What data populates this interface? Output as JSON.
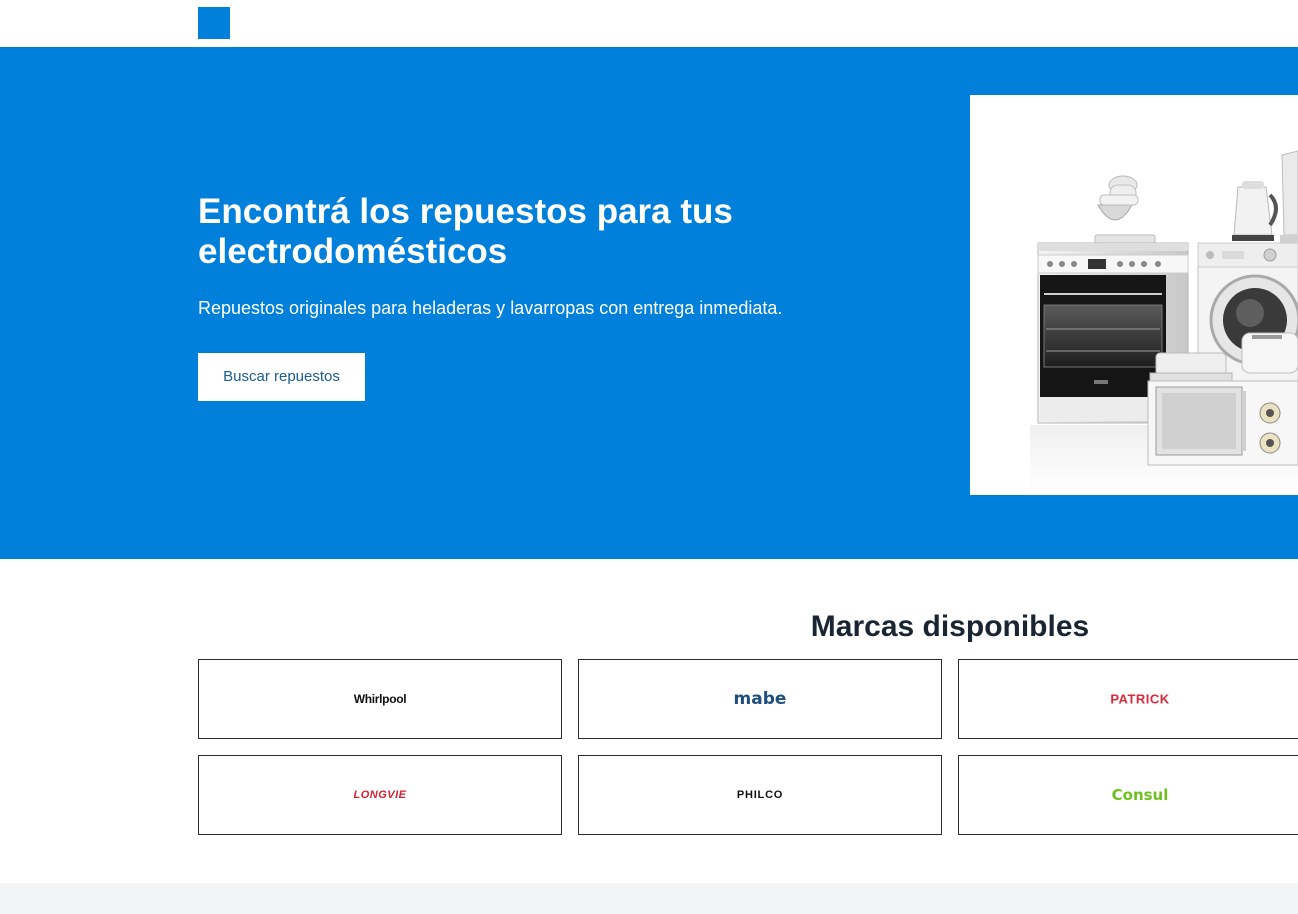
{
  "hero": {
    "title": "Encontrá los repuestos para tus electrodomésticos",
    "subtitle": "Repuestos originales para heladeras y lavarropas con entrega inmediata.",
    "button_label": "Buscar repuestos"
  },
  "brands": {
    "title": "Marcas disponibles",
    "items": [
      {
        "name": "Whirlpool"
      },
      {
        "name": "mabe"
      },
      {
        "name": "PATRICK"
      },
      {
        "name": "LONGVIE"
      },
      {
        "name": "PHILCO"
      },
      {
        "name": "Consul"
      }
    ]
  },
  "colors": {
    "brand_blue": "#0080DB",
    "heading_dark": "#1A2533",
    "button_text": "#1C5C93",
    "footer_gray": "#F2F3F5"
  }
}
